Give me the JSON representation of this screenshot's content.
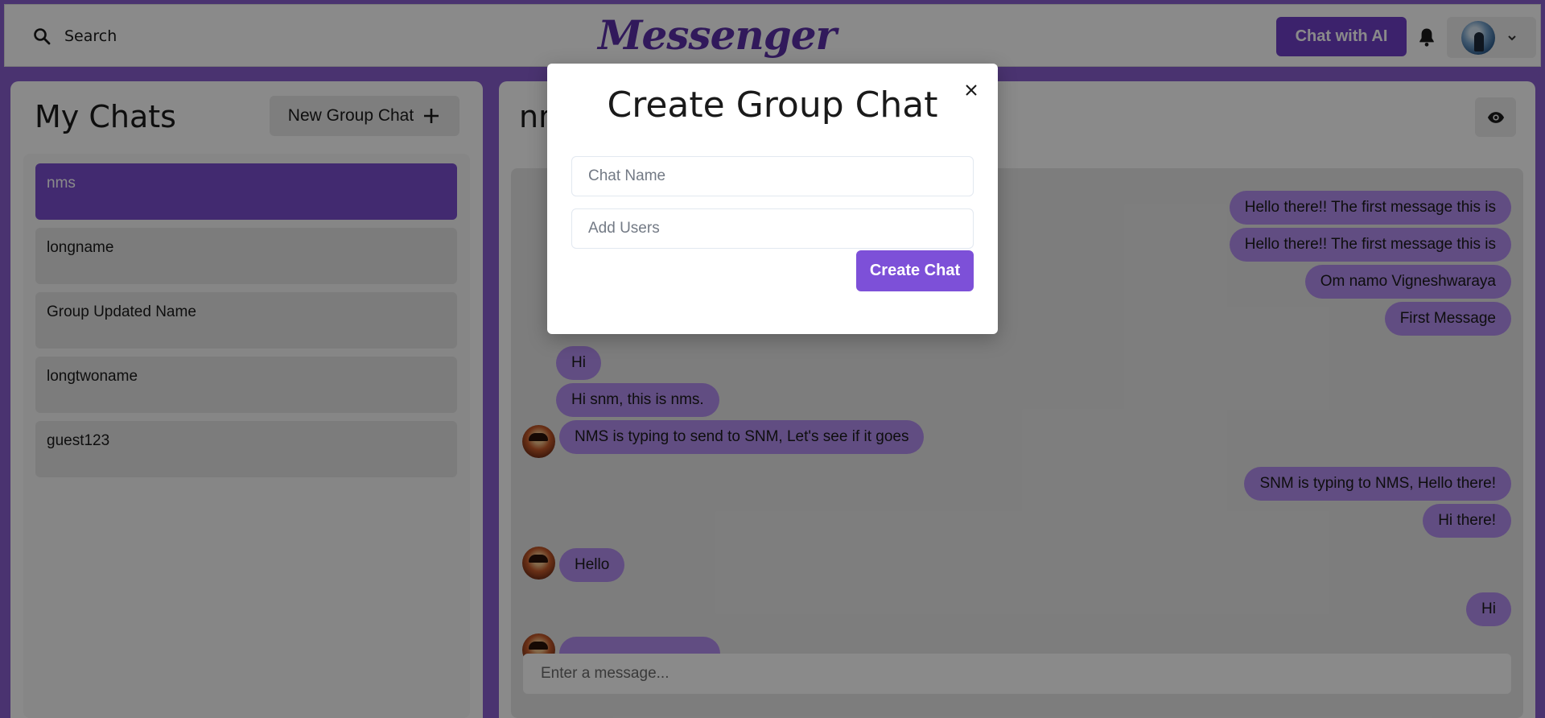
{
  "topbar": {
    "search_label": "Search",
    "logo": "Messenger",
    "ai_button": "Chat with AI"
  },
  "sidebar": {
    "title": "My Chats",
    "new_group_label": "New Group Chat",
    "chats": [
      {
        "name": "nms",
        "active": true
      },
      {
        "name": "longname",
        "active": false
      },
      {
        "name": "Group Updated Name",
        "active": false
      },
      {
        "name": "longtwoname",
        "active": false
      },
      {
        "name": "guest123",
        "active": false
      }
    ]
  },
  "chat": {
    "title": "nms",
    "input_placeholder": "Enter a message...",
    "messages": [
      {
        "text": "Hello there!! The first message this is",
        "from": "me"
      },
      {
        "text": "Hello there!! The first message this is",
        "from": "me"
      },
      {
        "text": "Om namo Vigneshwaraya",
        "from": "me"
      },
      {
        "text": "First Message",
        "from": "me"
      },
      {
        "text": "Hi",
        "from": "them"
      },
      {
        "text": "Hi snm, this is nms.",
        "from": "them"
      },
      {
        "text": "NMS is typing to send to SNM, Let's see if it goes",
        "from": "them"
      },
      {
        "text": "SNM is typing to NMS, Hello there!",
        "from": "me"
      },
      {
        "text": "Hi there!",
        "from": "me"
      },
      {
        "text": "Hello",
        "from": "them"
      },
      {
        "text": "Hi",
        "from": "me"
      }
    ]
  },
  "modal": {
    "title": "Create Group Chat",
    "chat_name_placeholder": "Chat Name",
    "add_users_placeholder": "Add Users",
    "create_button": "Create Chat"
  },
  "colors": {
    "accent": "#7d50d8",
    "background": "#8a5fd0",
    "bubble": "#b48ef0"
  },
  "icons": [
    "search-icon",
    "bell-icon",
    "chevron-down-icon",
    "plus-icon",
    "eye-icon",
    "close-icon"
  ]
}
